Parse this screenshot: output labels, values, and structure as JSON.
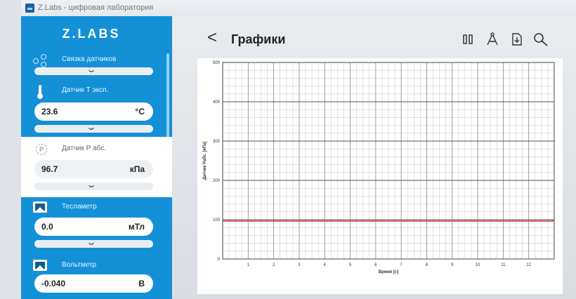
{
  "window": {
    "title": "Z.Labs - цифровая лаборатория"
  },
  "sidebar": {
    "brand": "Z.LABS",
    "sensors": [
      {
        "label": "Связка датчиков",
        "icon": "sensor-link-icon"
      },
      {
        "label": "Датчик Т эксп.",
        "icon": "thermometer-icon",
        "value": "23.6",
        "unit": "°C"
      },
      {
        "label": "Датчик Р абс.",
        "icon": "pressure-sensor-icon",
        "value": "96.7",
        "unit": "кПа",
        "active": true
      },
      {
        "label": "Тесламетр",
        "icon": "sensor-image-icon",
        "value": "0.0",
        "unit": "мТл"
      },
      {
        "label": "Вольтметр",
        "icon": "sensor-image-icon",
        "value": "-0.040",
        "unit": "В"
      }
    ]
  },
  "main": {
    "title": "Графики",
    "toolbar": [
      "pause-icon",
      "compass-icon",
      "export-icon",
      "search-icon"
    ]
  },
  "chart_data": {
    "type": "line",
    "xlabel": "Время [c]",
    "ylabel": "Датчик Рабс. [кПа]",
    "xlim": [
      0,
      13
    ],
    "ylim": [
      0,
      500
    ],
    "x_ticks": [
      1,
      2,
      3,
      4,
      5,
      6,
      7,
      8,
      9,
      10,
      11,
      12
    ],
    "y_ticks": [
      0,
      100,
      200,
      300,
      400,
      500
    ],
    "grid": true,
    "series": [
      {
        "color": "#e0574f",
        "x": [
          0,
          13
        ],
        "y": [
          96.7,
          96.7
        ]
      }
    ]
  }
}
